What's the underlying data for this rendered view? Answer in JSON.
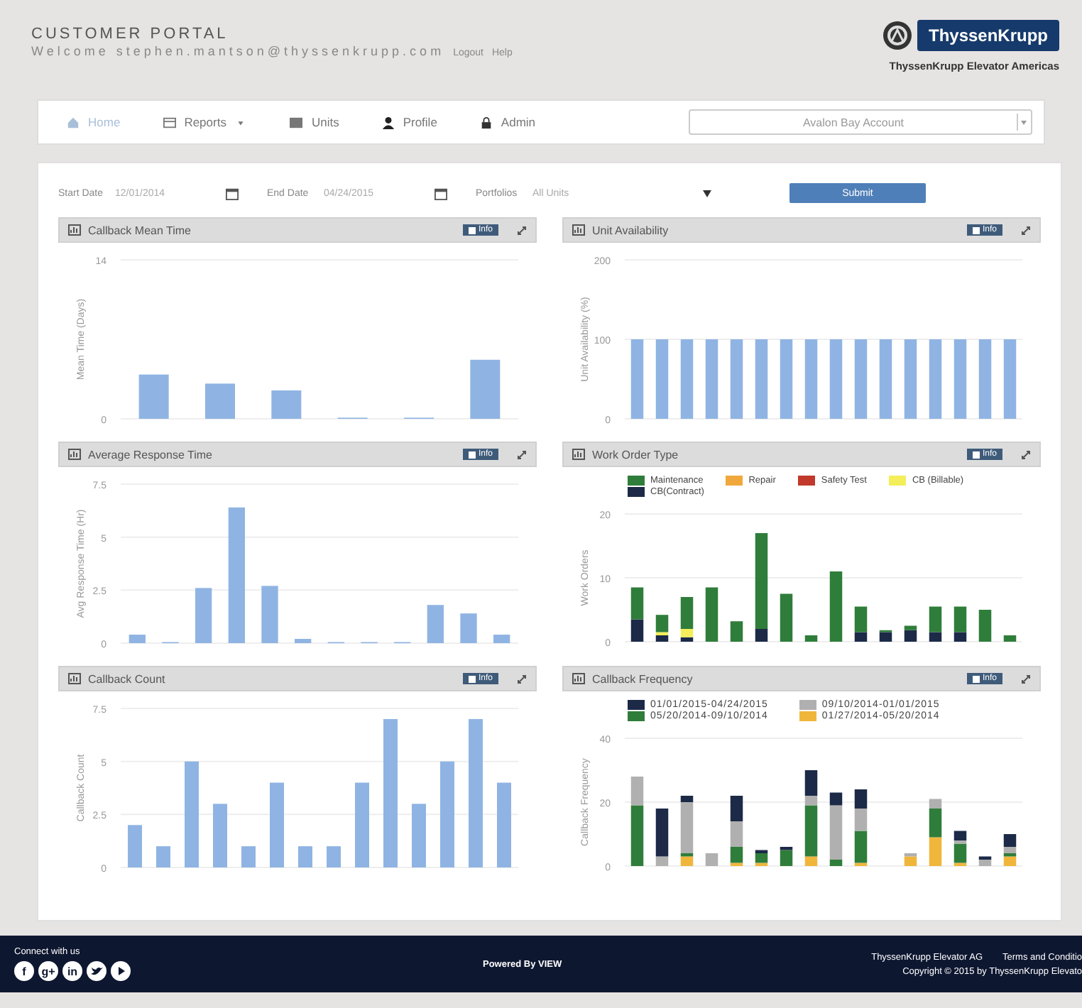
{
  "header": {
    "title": "CUSTOMER PORTAL",
    "welcome": "Welcome stephen.mantson@thyssenkrupp.com",
    "links": [
      "Logout",
      "Help"
    ],
    "logo": "ThyssenKrupp",
    "company": "ThyssenKrupp Elevator Americas"
  },
  "nav": {
    "items": [
      {
        "label": "Home",
        "selected": true,
        "dropdown": false
      },
      {
        "label": "Reports",
        "selected": false,
        "dropdown": true
      },
      {
        "label": "Units",
        "selected": false,
        "dropdown": false
      },
      {
        "label": "Profile",
        "selected": false,
        "dropdown": false
      },
      {
        "label": "Admin",
        "selected": false,
        "dropdown": false
      }
    ],
    "account": "Avalon Bay Account"
  },
  "filters": {
    "start_label": "Start Date",
    "start_value": "12/01/2014",
    "end_label": "End Date",
    "end_value": "04/24/2015",
    "portfolios_label": "Portfolios",
    "portfolios_value": "All Units",
    "submit": "Submit"
  },
  "panels": [
    {
      "title": "Callback Mean Time",
      "info": "Info",
      "chart_data": {
        "type": "bar",
        "ylabel": "Mean Time (Days)",
        "ylim": [
          0,
          14
        ],
        "yticks": [
          0,
          14
        ],
        "stacked": false,
        "series": [
          {
            "color": "#8fb4e3",
            "values": [
              3.9,
              3.1,
              2.5,
              0.1,
              0.1,
              5.2
            ]
          }
        ]
      }
    },
    {
      "title": "Unit Availability",
      "info": "Info",
      "chart_data": {
        "type": "bar",
        "ylabel": "Unit Availability (%)",
        "ylim": [
          0,
          200
        ],
        "yticks": [
          0,
          100,
          200
        ],
        "stacked": false,
        "series": [
          {
            "color": "#8fb4e3",
            "values": [
              100,
              100,
              100,
              100,
              100,
              100,
              100,
              100,
              100,
              100,
              100,
              100,
              100,
              100,
              100,
              100
            ]
          }
        ]
      }
    },
    {
      "title": "Average Response Time",
      "info": "Info",
      "chart_data": {
        "type": "bar",
        "ylabel": "Avg Response Time (Hr)",
        "ylim": [
          0,
          7.5
        ],
        "yticks": [
          0,
          2.5,
          5,
          7.5
        ],
        "stacked": false,
        "series": [
          {
            "color": "#8fb4e3",
            "values": [
              0.4,
              0.05,
              2.6,
              6.4,
              2.7,
              0.2,
              0.05,
              0.05,
              0.05,
              1.8,
              1.4,
              0.4
            ]
          }
        ]
      }
    },
    {
      "title": "Work Order Type",
      "info": "Info",
      "chart_data": {
        "type": "bar",
        "ylabel": "Work Orders",
        "ylim": [
          0,
          20
        ],
        "yticks": [
          0,
          10,
          20
        ],
        "stacked": true,
        "series": [
          {
            "name": "CB(Contract)",
            "color": "#1c2a48",
            "values": [
              3.5,
              1,
              0.7,
              0,
              0,
              2,
              0,
              0,
              0,
              1.5,
              1.5,
              1.8,
              1.5,
              1.5,
              0,
              0
            ]
          },
          {
            "name": "CB (Billable)",
            "color": "#f3ee5a",
            "values": [
              0,
              0.5,
              1.3,
              0,
              0,
              0,
              0,
              0,
              0,
              0,
              0,
              0,
              0,
              0,
              0,
              0
            ]
          },
          {
            "name": "Safety Test",
            "color": "#c0392b",
            "values": [
              0,
              0,
              0,
              0,
              0,
              0,
              0,
              0,
              0,
              0,
              0,
              0,
              0,
              0,
              0,
              0
            ]
          },
          {
            "name": "Repair",
            "color": "#f0a83c",
            "values": [
              0,
              0,
              0,
              0,
              0,
              0,
              0,
              0,
              0,
              0,
              0,
              0,
              0,
              0,
              0,
              0
            ]
          },
          {
            "name": "Maintenance",
            "color": "#2f7d3a",
            "values": [
              5,
              2.7,
              5,
              8.5,
              3.2,
              15,
              7.5,
              1,
              11,
              4,
              0.3,
              0.7,
              4,
              4,
              5,
              1
            ]
          }
        ]
      }
    },
    {
      "title": "Callback Count",
      "info": "Info",
      "chart_data": {
        "type": "bar",
        "ylabel": "Callback Count",
        "ylim": [
          0,
          7.5
        ],
        "yticks": [
          0,
          2.5,
          5,
          7.5
        ],
        "stacked": false,
        "series": [
          {
            "color": "#8fb4e3",
            "values": [
              2,
              1,
              5,
              3,
              1,
              4,
              1,
              1,
              4,
              7,
              3,
              5,
              7,
              4
            ]
          }
        ]
      }
    },
    {
      "title": "Callback Frequency",
      "info": "Info",
      "chart_data": {
        "type": "bar",
        "ylabel": "Callback Frequency",
        "ylim": [
          0,
          40
        ],
        "yticks": [
          0,
          20,
          40
        ],
        "stacked": true,
        "series": [
          {
            "name": "01/27/2014-05/20/2014",
            "color": "#f0b63c",
            "values": [
              0,
              0,
              3,
              0,
              1,
              1,
              0,
              3,
              0,
              1,
              0,
              3,
              9,
              1,
              0,
              3
            ]
          },
          {
            "name": "05/20/2014-09/10/2014",
            "color": "#2f7d3a",
            "values": [
              19,
              0,
              1,
              0,
              5,
              3,
              5,
              16,
              2,
              10,
              0,
              0,
              9,
              6,
              0,
              1
            ]
          },
          {
            "name": "09/10/2014-01/01/2015",
            "color": "#b0b0b0",
            "values": [
              9,
              3,
              16,
              4,
              8,
              0,
              0,
              3,
              17,
              7,
              0,
              1,
              3,
              1,
              2,
              2
            ]
          },
          {
            "name": "01/01/2015-04/24/2015",
            "color": "#1c2a48",
            "values": [
              0,
              15,
              2,
              0,
              8,
              1,
              1,
              8,
              4,
              6,
              0,
              0,
              0,
              3,
              1,
              4
            ]
          }
        ]
      }
    }
  ],
  "footer": {
    "connect": "Connect with us",
    "social": [
      {
        "kind": "text",
        "label": "f"
      },
      {
        "kind": "text",
        "label": "g+"
      },
      {
        "kind": "text",
        "label": "in"
      },
      {
        "kind": "bird"
      },
      {
        "kind": "play"
      }
    ],
    "powered": "Powered By VIEW",
    "company": "ThyssenKrupp Elevator AG",
    "terms": "Terms and Conditio",
    "copyright": "Copyright © 2015 by ThyssenKrupp Elevato"
  }
}
